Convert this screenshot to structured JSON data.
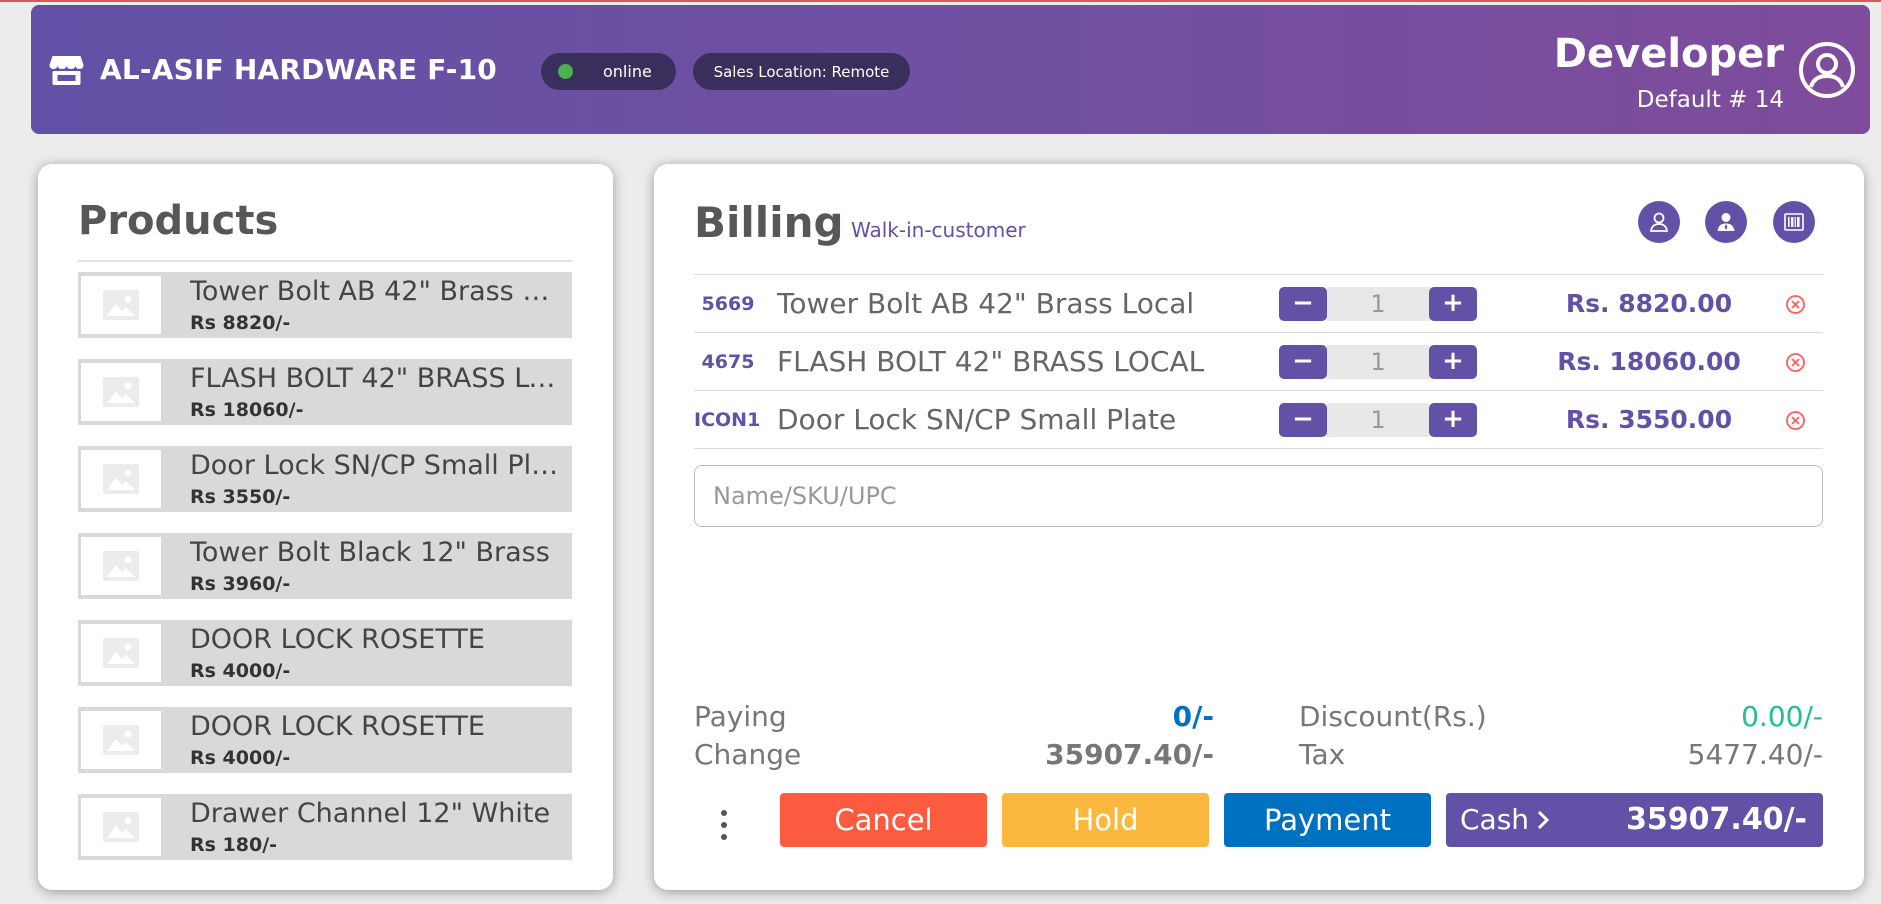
{
  "header": {
    "store_name": "AL-ASIF HARDWARE F-10",
    "status_label": "online",
    "status_color": "#4caf50",
    "location_label": "Sales Location: Remote",
    "user_name": "Developer",
    "user_sub": "Default # 14",
    "gradient": [
      "#6251a6",
      "#7e4c9b"
    ]
  },
  "products": {
    "title": "Products",
    "items": [
      {
        "name": "Tower Bolt AB 42\" Brass Local",
        "price": "Rs 8820/-"
      },
      {
        "name": "FLASH BOLT 42\" BRASS LOCAL",
        "price": "Rs 18060/-"
      },
      {
        "name": "Door Lock SN/CP Small Plate",
        "price": "Rs 3550/-"
      },
      {
        "name": "Tower Bolt Black 12\" Brass",
        "price": "Rs 3960/-"
      },
      {
        "name": "DOOR LOCK ROSETTE",
        "price": "Rs 4000/-"
      },
      {
        "name": "DOOR LOCK ROSETTE",
        "price": "Rs 4000/-"
      },
      {
        "name": "Drawer Channel 12\" White",
        "price": "Rs 180/-"
      }
    ]
  },
  "billing": {
    "title": "Billing",
    "customer": "Walk-in-customer",
    "icons": [
      "customer-icon",
      "add-user-icon",
      "barcode-icon"
    ],
    "rows": [
      {
        "sku": "5669",
        "name": "Tower Bolt AB 42\" Brass Local",
        "qty": "1",
        "total": "Rs. 8820.00"
      },
      {
        "sku": "4675",
        "name": "FLASH BOLT 42\" BRASS LOCAL",
        "qty": "1",
        "total": "Rs. 18060.00"
      },
      {
        "sku": "ICON1:",
        "name": "Door Lock SN/CP Small Plate",
        "qty": "1",
        "total": "Rs. 3550.00"
      }
    ],
    "search": {
      "placeholder": "Name/SKU/UPC",
      "value": ""
    },
    "summary": {
      "paying_label": "Paying",
      "paying_value": "0/-",
      "change_label": "Change",
      "change_value": "35907.40/-",
      "discount_label": "Discount(Rs.)",
      "discount_value": "0.00/-",
      "tax_label": "Tax",
      "tax_value": "5477.40/-"
    },
    "actions": {
      "cancel": "Cancel",
      "hold": "Hold",
      "payment": "Payment",
      "cash_label": "Cash",
      "cash_amount": "35907.40/-"
    },
    "colors": {
      "accent": "#6251a6",
      "cancel": "#fc5b3f",
      "hold": "#fbb83f",
      "payment": "#0070c0",
      "paying": "#0070c0",
      "discount": "#22c08a",
      "remove": "#ff5c5c"
    }
  }
}
